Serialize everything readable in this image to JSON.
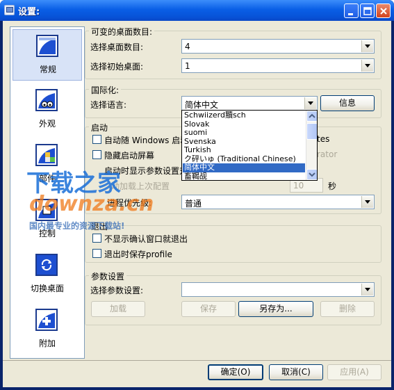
{
  "window": {
    "title": "设置:"
  },
  "nav": {
    "items": [
      {
        "label": "常规",
        "icon": "general-icon"
      },
      {
        "label": "外观",
        "icon": "appearance-icon"
      },
      {
        "label": "部件",
        "icon": "widgets-icon"
      },
      {
        "label": "控制",
        "icon": "control-icon"
      },
      {
        "label": "切换桌面",
        "icon": "switch-desktop-icon"
      },
      {
        "label": "附加",
        "icon": "addon-icon"
      }
    ]
  },
  "desktops": {
    "group_title": "可变的桌面数目:",
    "count_label": "选择桌面数目:",
    "count_value": "4",
    "initial_label": "选择初始桌面:",
    "initial_value": "1"
  },
  "i18n": {
    "group_title": "国际化:",
    "language_label": "选择语言:",
    "language_value": "简体中文",
    "info_button": "信息",
    "options": [
      "Schwiizerd黷sch",
      "Slovak",
      "suomi",
      "Svenska",
      "Turkish",
      "ク砰いゅ (Traditional Chinese)",
      "简体中文",
      "畜鞨觇"
    ],
    "selected_index": 6
  },
  "startup": {
    "group_title": "启动",
    "opt1": "自动随 Windows 启动",
    "opt2": "隐藏启动屏幕",
    "opt3": "启动时显示参数设置对",
    "opt4": "动加载上次配置",
    "partial_right1": "tes",
    "partial_right2": "rator",
    "delay_value": "10",
    "delay_unit": "秒",
    "priority_label": "进程优先级:",
    "priority_value": "普通"
  },
  "exit": {
    "group_title": "退出",
    "opt1": "不显示确认窗口就退出",
    "opt2": "退出时保存profile"
  },
  "params": {
    "group_title": "参数设置",
    "select_label": "选择参数设置:",
    "select_value": "",
    "load": "加载",
    "save": "保存",
    "save_as": "另存为...",
    "delete": "删除"
  },
  "footer": {
    "ok": "确定(O)",
    "cancel": "取消(C)",
    "apply": "应用(A)"
  },
  "watermark": {
    "line1": "下载之家",
    "line2": "downza.cn",
    "line3": "国内最专业的资源下载站!"
  },
  "colors": {
    "title_bar": "#0a5fe6",
    "selection": "#316ac5",
    "watermark_blue": "#1a6fd8",
    "watermark_orange": "#f07a1a"
  }
}
